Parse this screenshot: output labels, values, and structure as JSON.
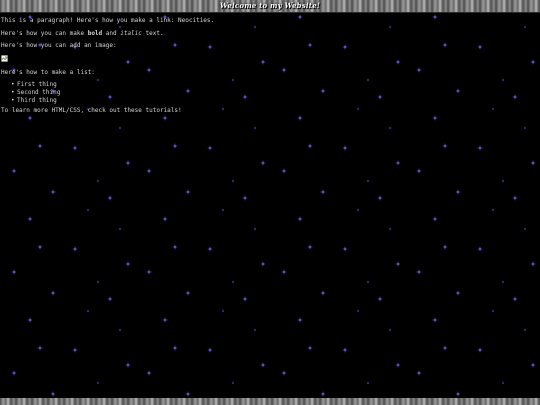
{
  "header": {
    "title": "Welcome to my Website!"
  },
  "content": {
    "paragraph_prefix": "This is a paragraph! Here's how you make a link: ",
    "link_text": "Neocities",
    "link_suffix": ".",
    "formatting_prefix": "Here's how you can make ",
    "bold_text": "bold",
    "formatting_middle": " and ",
    "italic_text": "italic",
    "formatting_suffix": " text.",
    "image_intro": "Here's how you can add an image:",
    "list_intro": "Here's how to make a list:",
    "list_items": [
      "First thing",
      "Second thing",
      "Third thing"
    ],
    "learn_prefix": "To learn more HTML/CSS, check out these ",
    "tutorials_link": "tutorials",
    "learn_suffix": "!"
  },
  "icons": {
    "broken_image": "broken-image-icon",
    "bullet": "disc-bullet-icon"
  },
  "colors": {
    "background": "#000000",
    "text": "#d6d6d6",
    "star": "#5a5aff"
  }
}
